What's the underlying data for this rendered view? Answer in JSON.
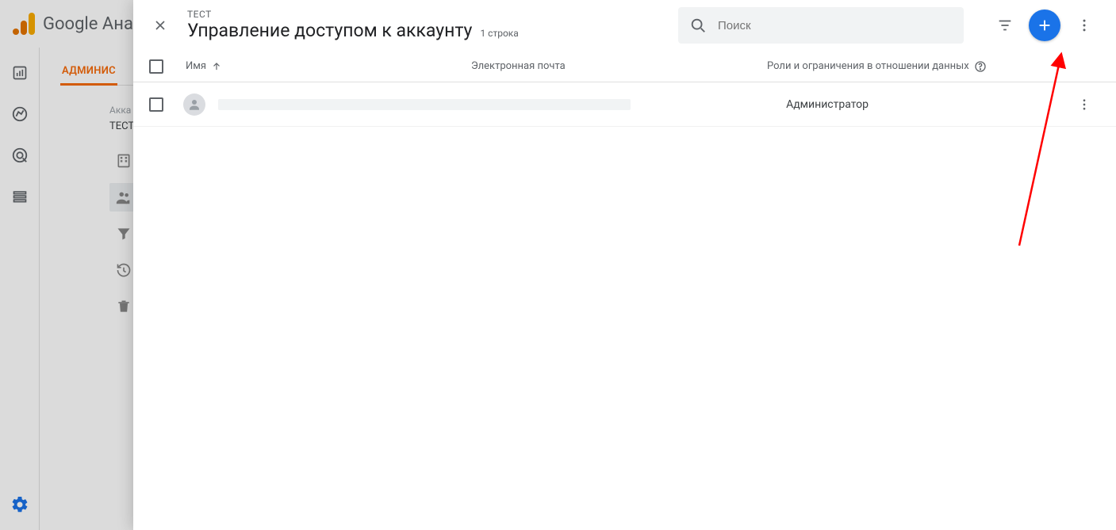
{
  "app": {
    "product_name": "Google Анал"
  },
  "admin": {
    "tab_label": "АДМИНИС",
    "account_label": "Акка",
    "account_name": "ТЕСТ"
  },
  "modal": {
    "eyebrow": "ТЕСТ",
    "title": "Управление доступом к аккаунту",
    "row_count_label": "1 строка",
    "search_placeholder": "Поиск",
    "columns": {
      "name": "Имя",
      "email": "Электронная почта",
      "roles": "Роли и ограничения в отношении данных"
    },
    "rows": [
      {
        "role": "Администратор"
      }
    ]
  }
}
